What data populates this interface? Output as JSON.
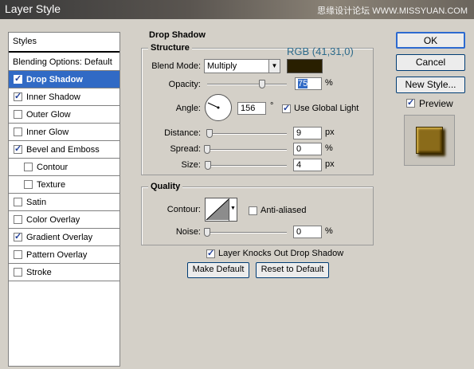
{
  "window": {
    "title": "Layer Style",
    "watermark": "思缘设计论坛  WWW.MISSYUAN.COM"
  },
  "list": {
    "header": "Styles",
    "blending": "Blending Options: Default",
    "items": [
      {
        "label": "Drop Shadow",
        "checked": true,
        "selected": true,
        "sub": false
      },
      {
        "label": "Inner Shadow",
        "checked": true,
        "selected": false,
        "sub": false
      },
      {
        "label": "Outer Glow",
        "checked": false,
        "selected": false,
        "sub": false
      },
      {
        "label": "Inner Glow",
        "checked": false,
        "selected": false,
        "sub": false
      },
      {
        "label": "Bevel and Emboss",
        "checked": true,
        "selected": false,
        "sub": false
      },
      {
        "label": "Contour",
        "checked": false,
        "selected": false,
        "sub": true
      },
      {
        "label": "Texture",
        "checked": false,
        "selected": false,
        "sub": true
      },
      {
        "label": "Satin",
        "checked": false,
        "selected": false,
        "sub": false
      },
      {
        "label": "Color Overlay",
        "checked": false,
        "selected": false,
        "sub": false
      },
      {
        "label": "Gradient Overlay",
        "checked": true,
        "selected": false,
        "sub": false
      },
      {
        "label": "Pattern Overlay",
        "checked": false,
        "selected": false,
        "sub": false
      },
      {
        "label": "Stroke",
        "checked": false,
        "selected": false,
        "sub": false
      }
    ]
  },
  "drop_shadow": {
    "title": "Drop Shadow",
    "structure": {
      "title": "Structure",
      "rgb_note": "RGB (41,31,0)",
      "blend_mode_label": "Blend Mode:",
      "blend_mode_value": "Multiply",
      "shadow_color": "#291f00",
      "opacity_label": "Opacity:",
      "opacity_value": "75",
      "opacity_fraction": 0.75,
      "percent": "%",
      "angle_label": "Angle:",
      "angle_value": "156",
      "degree": "°",
      "use_global_light": "Use Global Light",
      "use_global_light_checked": true,
      "distance_label": "Distance:",
      "distance_value": "9",
      "distance_fraction": 0.03,
      "spread_label": "Spread:",
      "spread_value": "0",
      "spread_fraction": 0,
      "size_label": "Size:",
      "size_value": "4",
      "size_fraction": 0.016,
      "px": "px"
    },
    "quality": {
      "title": "Quality",
      "contour_label": "Contour:",
      "anti_aliased": "Anti-aliased",
      "anti_aliased_checked": false,
      "noise_label": "Noise:",
      "noise_value": "0",
      "noise_fraction": 0,
      "percent": "%"
    },
    "knocks_out": "Layer Knocks Out Drop Shadow",
    "knocks_out_checked": true,
    "make_default": "Make Default",
    "reset_default": "Reset to Default"
  },
  "buttons": {
    "ok": "OK",
    "cancel": "Cancel",
    "new_style": "New Style...",
    "preview": "Preview",
    "preview_checked": true
  },
  "colors": {
    "accent": "#316ac5",
    "rgb_note": "#2d6a8a",
    "preview_tile": "#8a6b1a"
  }
}
